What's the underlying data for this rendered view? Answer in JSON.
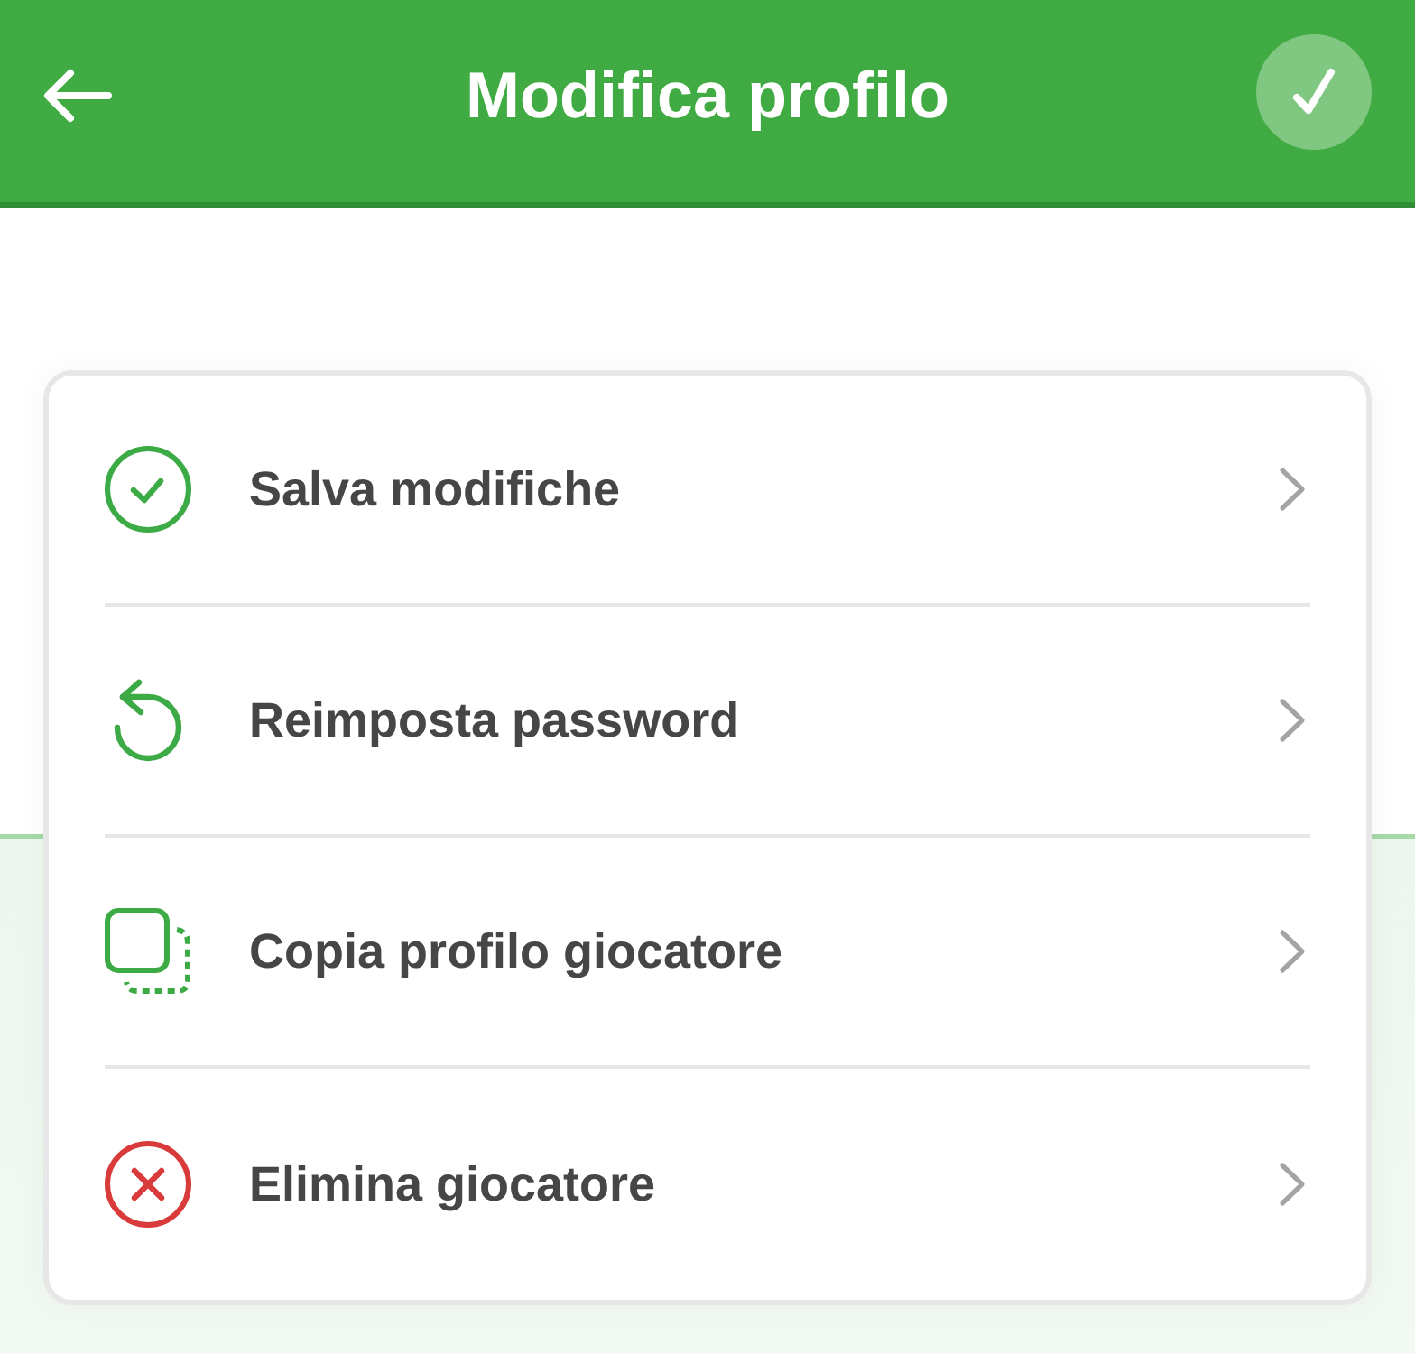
{
  "header": {
    "title": "Modifica profilo"
  },
  "menu": {
    "items": [
      {
        "label": "Salva modifiche",
        "color": "#3dab45"
      },
      {
        "label": "Reimposta password",
        "color": "#3dab45"
      },
      {
        "label": "Copia profilo giocatore",
        "color": "#3dab45"
      },
      {
        "label": "Elimina giocatore",
        "color": "#d93a3a"
      }
    ]
  }
}
